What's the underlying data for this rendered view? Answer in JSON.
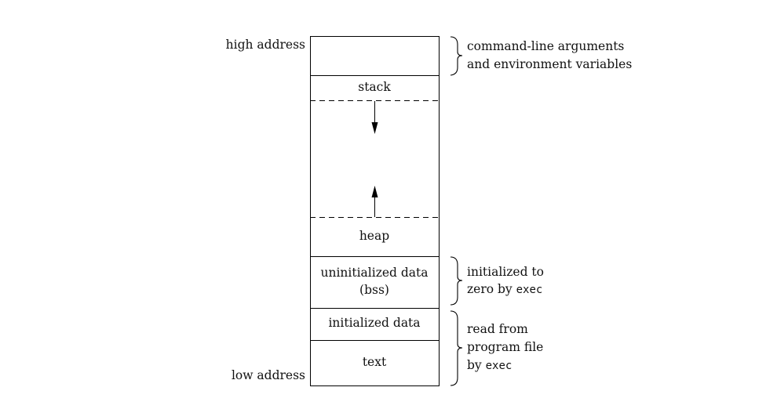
{
  "left_labels": {
    "high": "high address",
    "low": "low address"
  },
  "segments": {
    "stack": "stack",
    "heap": "heap",
    "bss_line1": "uninitialized data",
    "bss_line2": "(bss)",
    "data": "initialized data",
    "text": "text"
  },
  "annotations": {
    "args_line1": "command-line arguments",
    "args_line2": "and environment variables",
    "bss_line1": "initialized to",
    "bss_line2_prefix": "zero by ",
    "bss_line2_code": "exec",
    "text_line1": "read from",
    "text_line2": "program file",
    "text_line3_prefix": "by ",
    "text_line3_code": "exec"
  }
}
